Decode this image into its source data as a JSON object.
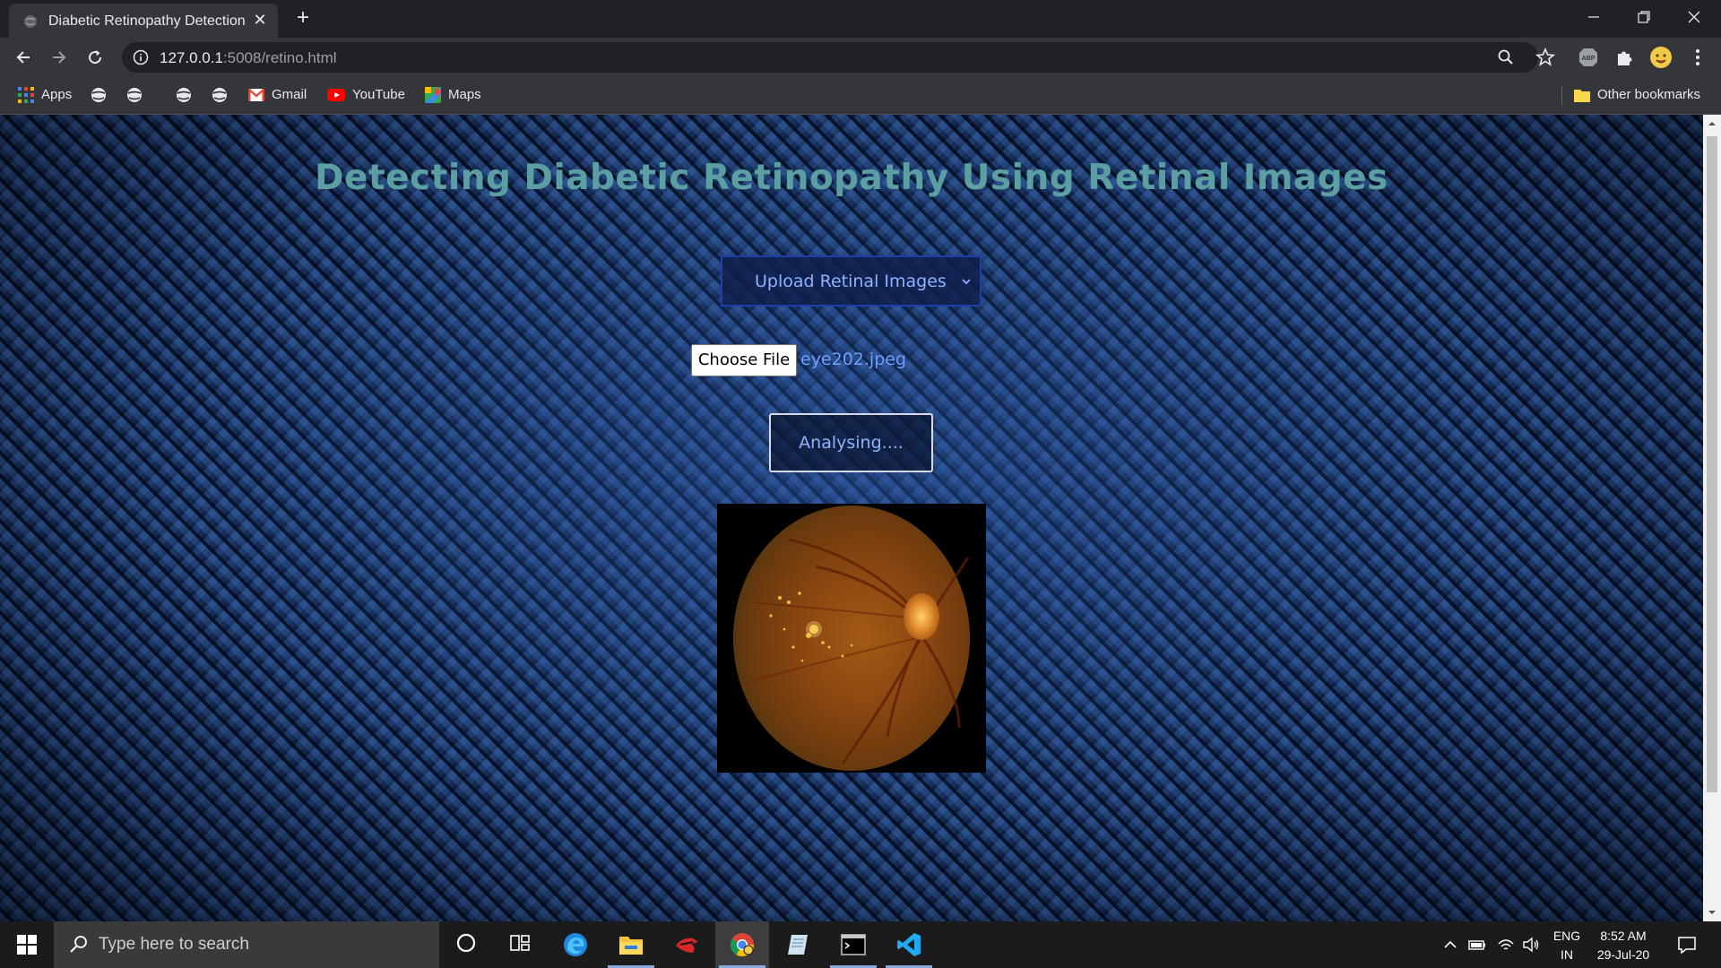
{
  "browser": {
    "tab_title": "Diabetic Retinopathy Detection",
    "url_host": "127.0.0.1",
    "url_rest": ":5008/retino.html",
    "bookmarks": {
      "apps": "Apps",
      "gmail": "Gmail",
      "youtube": "YouTube",
      "maps": "Maps",
      "other": "Other bookmarks"
    }
  },
  "page": {
    "title": "Detecting Diabetic Retinopathy Using Retinal Images",
    "upload_select_label": "Upload Retinal Images",
    "choose_file_label": "Choose File",
    "selected_file": "eye202.jpeg",
    "analyse_button_label": "Analysing...."
  },
  "taskbar": {
    "search_placeholder": "Type here to search",
    "language": "ENG",
    "region": "IN",
    "time": "8:52 AM",
    "date": "29-Jul-20"
  },
  "colors": {
    "title": "#5b9fa3",
    "accent_text": "#8fb2ff",
    "page_bg": "#0f2240"
  }
}
